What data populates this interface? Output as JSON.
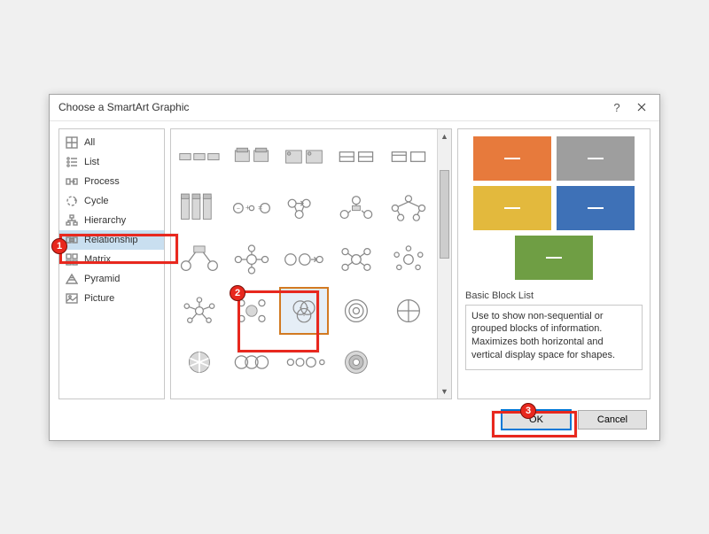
{
  "dialog": {
    "title": "Choose a SmartArt Graphic",
    "help_label": "?",
    "close_label": "Close"
  },
  "categories": [
    {
      "icon": "all",
      "label": "All"
    },
    {
      "icon": "list",
      "label": "List"
    },
    {
      "icon": "process",
      "label": "Process"
    },
    {
      "icon": "cycle",
      "label": "Cycle"
    },
    {
      "icon": "hierarchy",
      "label": "Hierarchy"
    },
    {
      "icon": "relationship",
      "label": "Relationship",
      "selected": true
    },
    {
      "icon": "matrix",
      "label": "Matrix"
    },
    {
      "icon": "pyramid",
      "label": "Pyramid"
    },
    {
      "icon": "picture",
      "label": "Picture"
    }
  ],
  "gallery": {
    "selected_index": 17,
    "selected_name": "Basic Venn"
  },
  "preview": {
    "swatches": [
      "#e77a3c",
      "#9e9e9e",
      "#e3b93d",
      "#3e71b7",
      "#6f9e44"
    ],
    "title": "Basic Block List",
    "description": "Use to show non-sequential or grouped blocks of information. Maximizes both horizontal and vertical display space for shapes."
  },
  "buttons": {
    "ok": "OK",
    "cancel": "Cancel"
  },
  "callouts": {
    "m1": "1",
    "m2": "2",
    "m3": "3"
  }
}
